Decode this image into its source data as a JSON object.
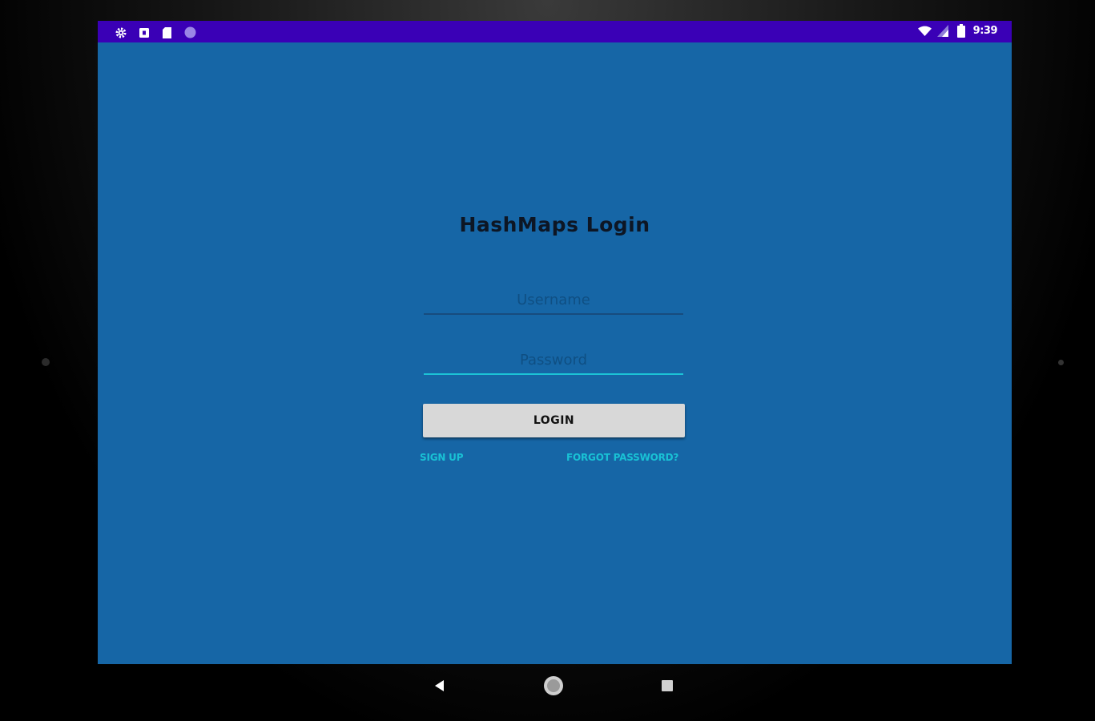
{
  "statusbar": {
    "left_icons": [
      "settings-icon",
      "notification-box-icon",
      "sd-card-icon",
      "circle-icon"
    ],
    "right_icons": [
      "wifi-icon",
      "cell-signal-icon",
      "battery-icon"
    ],
    "time": "9:39"
  },
  "login": {
    "title": "HashMaps Login",
    "username_placeholder": "Username",
    "username_value": "",
    "password_placeholder": "Password",
    "password_value": "",
    "login_label": "LOGIN",
    "signup_label": "SIGN UP",
    "forgot_label": "FORGOT PASSWORD?"
  },
  "navbar": {
    "icons": [
      "back-icon",
      "home-icon",
      "recents-icon"
    ]
  },
  "colors": {
    "background": "#1666a6",
    "statusbar": "#3a00b6",
    "accent": "#19c2d5",
    "button": "#d8d8d8"
  }
}
